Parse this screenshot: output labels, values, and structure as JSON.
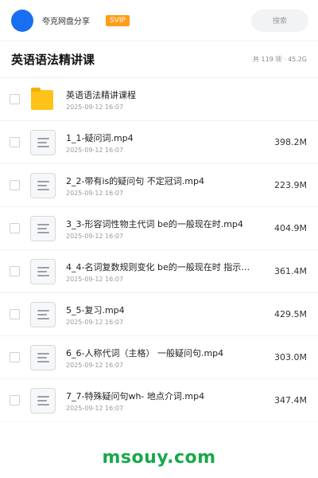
{
  "header": {
    "brand": "夸克网盘分享",
    "vip_badge": "SVIP",
    "search_placeholder": "搜索"
  },
  "title_bar": {
    "title": "英语语法精讲课",
    "summary": "共 119 项 · 45.2G"
  },
  "files": [
    {
      "name": "英语语法精讲课程",
      "date": "2025-09-12 16:07",
      "size": "",
      "type": "folder"
    },
    {
      "name": "1_1-疑问词.mp4",
      "date": "2025-09-12 16:07",
      "size": "398.2M",
      "type": "file"
    },
    {
      "name": "2_2-带有is的疑问句 不定冠词.mp4",
      "date": "2025-09-12 16:07",
      "size": "223.9M",
      "type": "file"
    },
    {
      "name": "3_3-形容词性物主代词 be的一般现在时.mp4",
      "date": "2025-09-12 16:07",
      "size": "404.9M",
      "type": "file"
    },
    {
      "name": "4_4-名词复数规则变化 be的一般现在时 指示代…",
      "date": "2025-09-12 16:07",
      "size": "361.4M",
      "type": "file"
    },
    {
      "name": "5_5-复习.mp4",
      "date": "2025-09-12 16:07",
      "size": "429.5M",
      "type": "file"
    },
    {
      "name": "6_6-人称代词（主格） 一般疑问句.mp4",
      "date": "2025-09-12 16:07",
      "size": "303.0M",
      "type": "file"
    },
    {
      "name": "7_7-特殊疑问句wh- 地点介词.mp4",
      "date": "2025-09-12 16:07",
      "size": "347.4M",
      "type": "file"
    }
  ],
  "watermark": "msouy.com",
  "colors": {
    "avatar": "#1a6ff0",
    "vip_badge": "#ff9d18",
    "folder": "#ffc21a",
    "watermark": "#18a84a"
  }
}
